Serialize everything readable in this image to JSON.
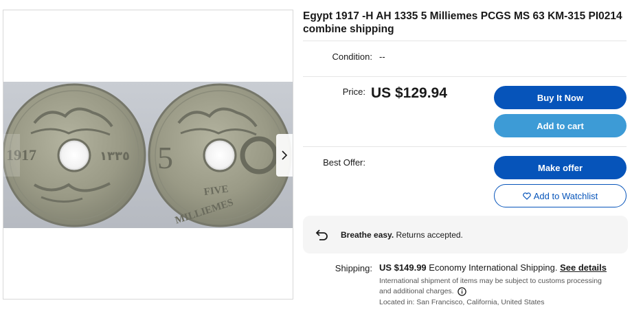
{
  "listing": {
    "title": "Egypt 1917 -H AH 1335 5 Milliemes PCGS MS 63 KM-315 PI0214 combine shipping"
  },
  "gallery": {
    "coin_left": {
      "year": "1917",
      "arabic_year": "١٣٣٥"
    },
    "coin_right": {
      "numeral": "5",
      "line1": "FIVE",
      "line2": "MILLIEMES"
    }
  },
  "condition": {
    "label": "Condition:",
    "value": "--"
  },
  "price": {
    "label": "Price:",
    "value": "US $129.94"
  },
  "buttons": {
    "buy_now": "Buy It Now",
    "add_to_cart": "Add to cart",
    "make_offer": "Make offer",
    "watchlist": "Add to Watchlist"
  },
  "best_offer": {
    "label": "Best Offer:"
  },
  "returns": {
    "bold": "Breathe easy.",
    "text": " Returns accepted."
  },
  "shipping": {
    "label": "Shipping:",
    "price": "US $149.99",
    "method": " Economy International Shipping. ",
    "details_link": "See details",
    "note_line1": "International shipment of items may be subject to customs processing",
    "note_line2": "and additional charges.",
    "location": "Located in: San Francisco, California, United States"
  },
  "colors": {
    "primary": "#0654ba",
    "secondary": "#3d9bd6",
    "coin_metal": "#9a9a87"
  }
}
